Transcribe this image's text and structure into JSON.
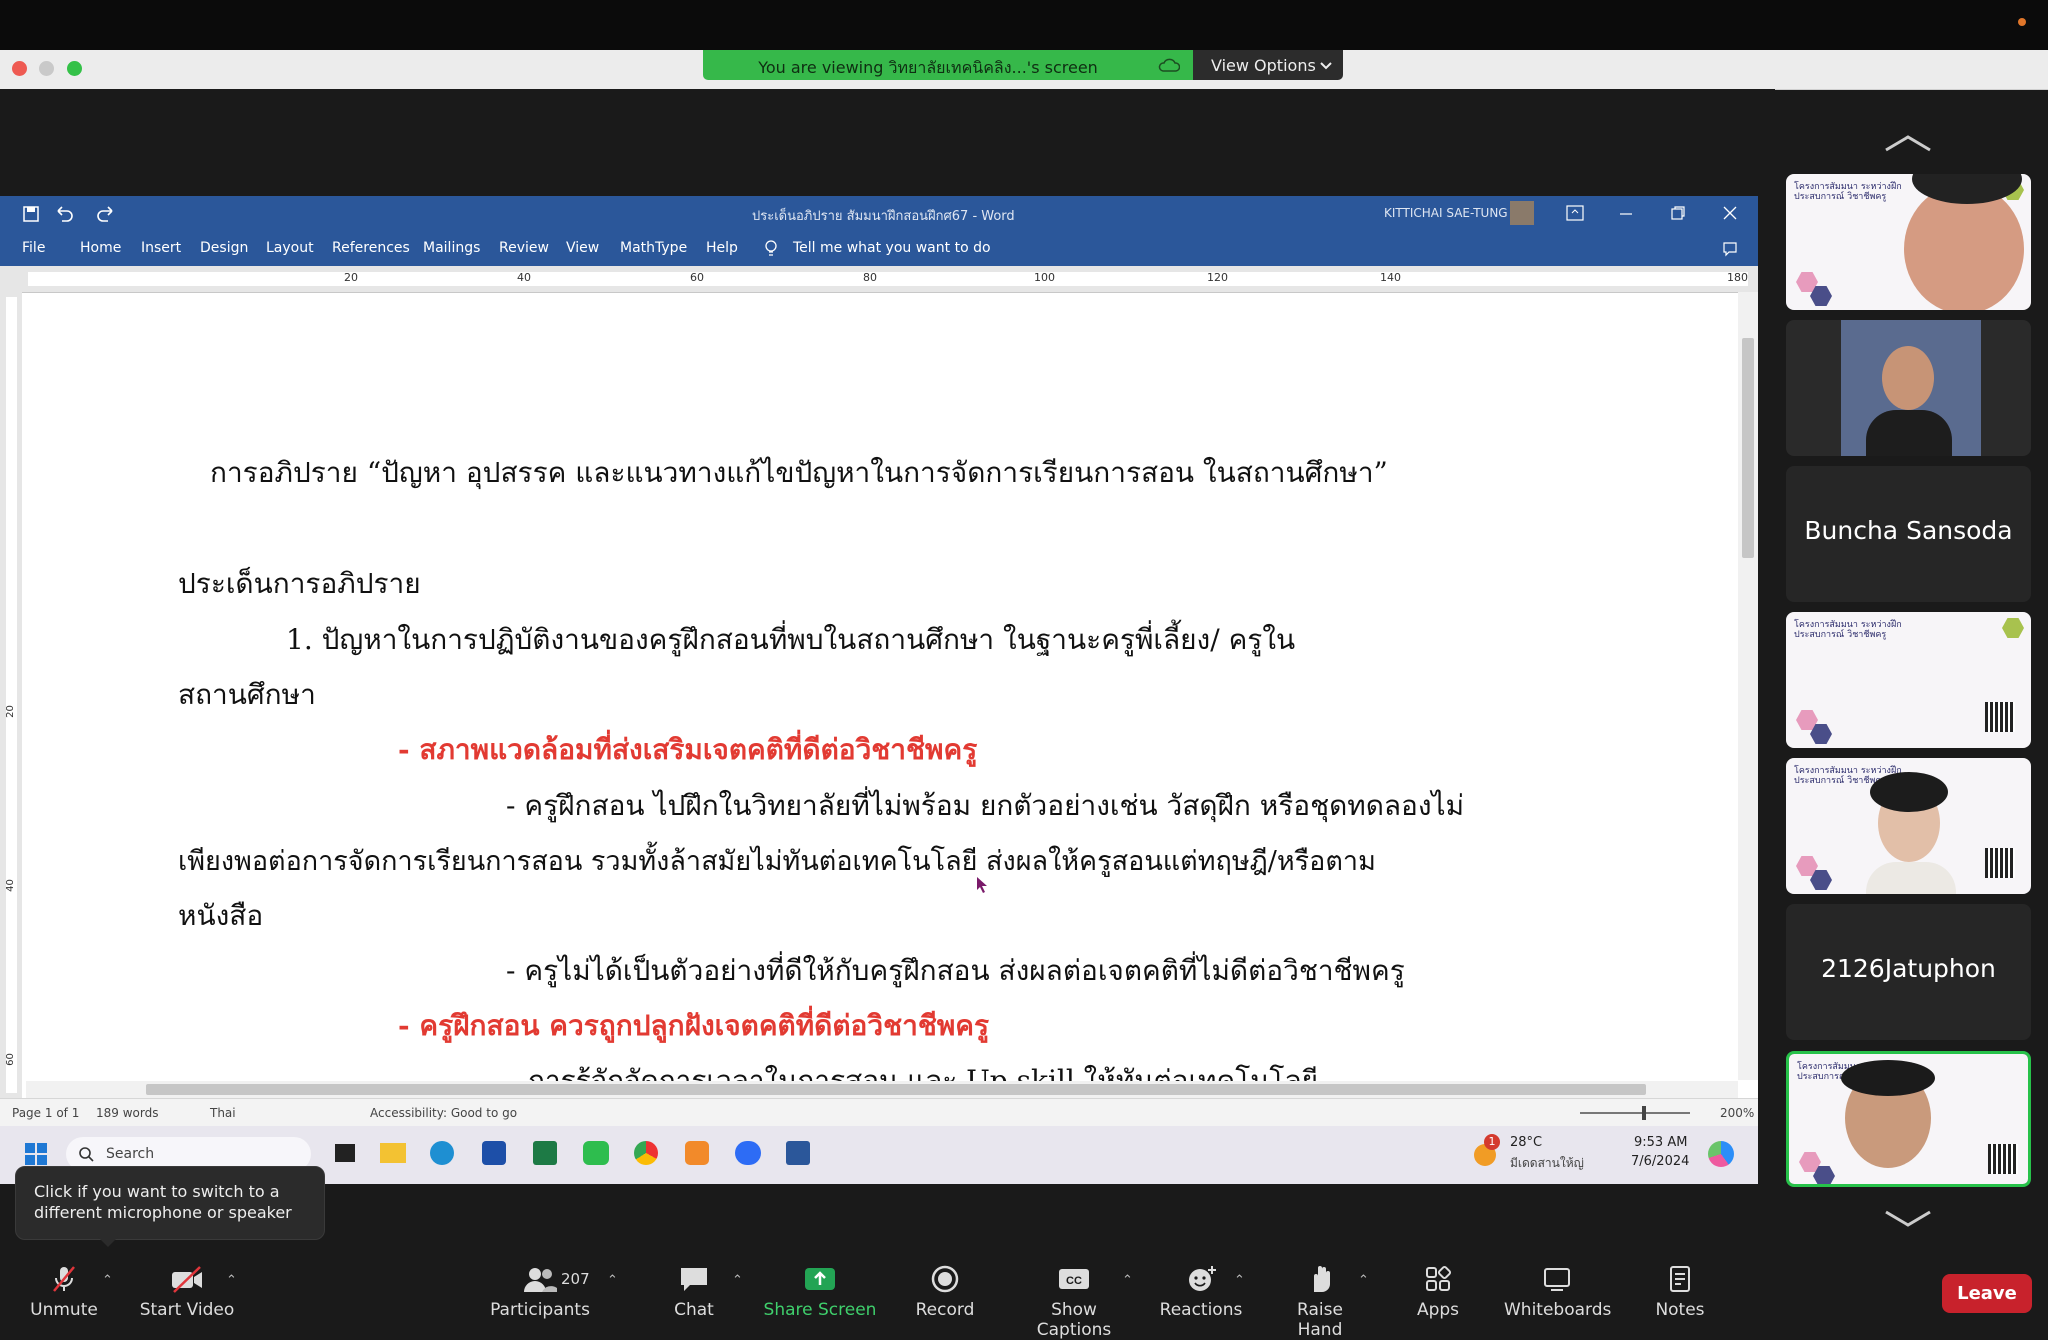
{
  "meeting": {
    "banner_text": "You are viewing วิทยาลัยเทคนิคลิง...'s screen",
    "view_options": "View Options"
  },
  "word": {
    "doc_title": "ประเด็นอภิปราย สัมมนาฝึกสอนฝึกศ67  -  Word",
    "user_name": "KITTICHAI SAE-TUNG",
    "menu": [
      "File",
      "Home",
      "Insert",
      "Design",
      "Layout",
      "References",
      "Mailings",
      "Review",
      "View",
      "MathType",
      "Help"
    ],
    "tell_me": "Tell me what you want to do",
    "ruler_numbers": [
      "20",
      "40",
      "60",
      "80",
      "100",
      "120",
      "140",
      "180"
    ],
    "left_ruler_numbers": [
      "20",
      "40",
      "60"
    ],
    "document": {
      "heading": "การอภิปราย “ปัญหา อุปสรรค และแนวทางแก้ไขปัญหาในการจัดการเรียนการสอน ในสถานศึกษา”",
      "section_title": "ประเด็นการอภิปราย",
      "item1_line1": "1. ปัญหาในการปฏิบัติงานของครูฝึกสอนที่พบในสถานศึกษา ในฐานะครูพี่เลี้ยง/ ครูใน",
      "item1_line2": "สถานศึกษา",
      "red1": "- สภาพแวดล้อมที่ส่งเสริมเจตคติที่ดีต่อวิชาชีพครู",
      "para1_line1": "- ครูฝึกสอน ไปฝึกในวิทยาลัยที่ไม่พร้อม ยกตัวอย่างเช่น วัสดุฝึก หรือชุดทดลองไม่",
      "para1_line2": "เพียงพอต่อการจัดการเรียนการสอน รวมทั้งล้าสมัยไม่ทันต่อเทคโนโลยี  ส่งผลให้ครูสอนแต่ทฤษฎี/หรือตาม",
      "para1_line3": "หนังสือ",
      "para2": "- ครูไม่ได้เป็นตัวอย่างที่ดีให้กับครูฝึกสอน ส่งผลต่อเจตคติที่ไม่ดีต่อวิชาชีพครู",
      "red2": "- ครูฝึกสอน ควรถูกปลูกฝังเจตคติที่ดีต่อวิชาชีพครู",
      "para3_partial": "การรู้จักจัดการเวลาในการสอน และ Up skill ให้ทันต่อเทคโนโลยี"
    },
    "status": {
      "page": "Page 1 of 1",
      "words": "189 words",
      "language": "Thai",
      "accessibility": "Accessibility: Good to go",
      "zoom": "200%"
    },
    "taskbar": {
      "search": "Search",
      "weather_temp": "28°C",
      "weather_loc": "มีเดดสานให้ญ่",
      "weather_badge": "1",
      "time": "9:53 AM",
      "date": "7/6/2024"
    }
  },
  "participants": [
    {
      "type": "video",
      "label": ""
    },
    {
      "type": "video",
      "label": ""
    },
    {
      "type": "name",
      "label": "Buncha Sansoda"
    },
    {
      "type": "video",
      "label": ""
    },
    {
      "type": "video",
      "label": ""
    },
    {
      "type": "name",
      "label": "2126Jatuphon"
    },
    {
      "type": "video",
      "label": ""
    }
  ],
  "slide_text": "โครงการสัมมนา ระหว่างฝึกประสบการณ์ วิชาชีพครู",
  "tooltip": "Click if you want to switch to a different microphone or speaker",
  "toolbar": {
    "unmute": "Unmute",
    "start_video": "Start Video",
    "participants": "Participants",
    "participant_count": "207",
    "chat": "Chat",
    "share_screen": "Share Screen",
    "record": "Record",
    "show_captions": "Show Captions",
    "reactions": "Reactions",
    "raise_hand": "Raise Hand",
    "apps": "Apps",
    "whiteboards": "Whiteboards",
    "notes": "Notes",
    "leave": "Leave"
  },
  "colors": {
    "word_blue": "#2b579a",
    "banner_green": "#36b84a",
    "leave_red": "#c8222c",
    "doc_red": "#e23a32",
    "share_green": "#23a454"
  }
}
